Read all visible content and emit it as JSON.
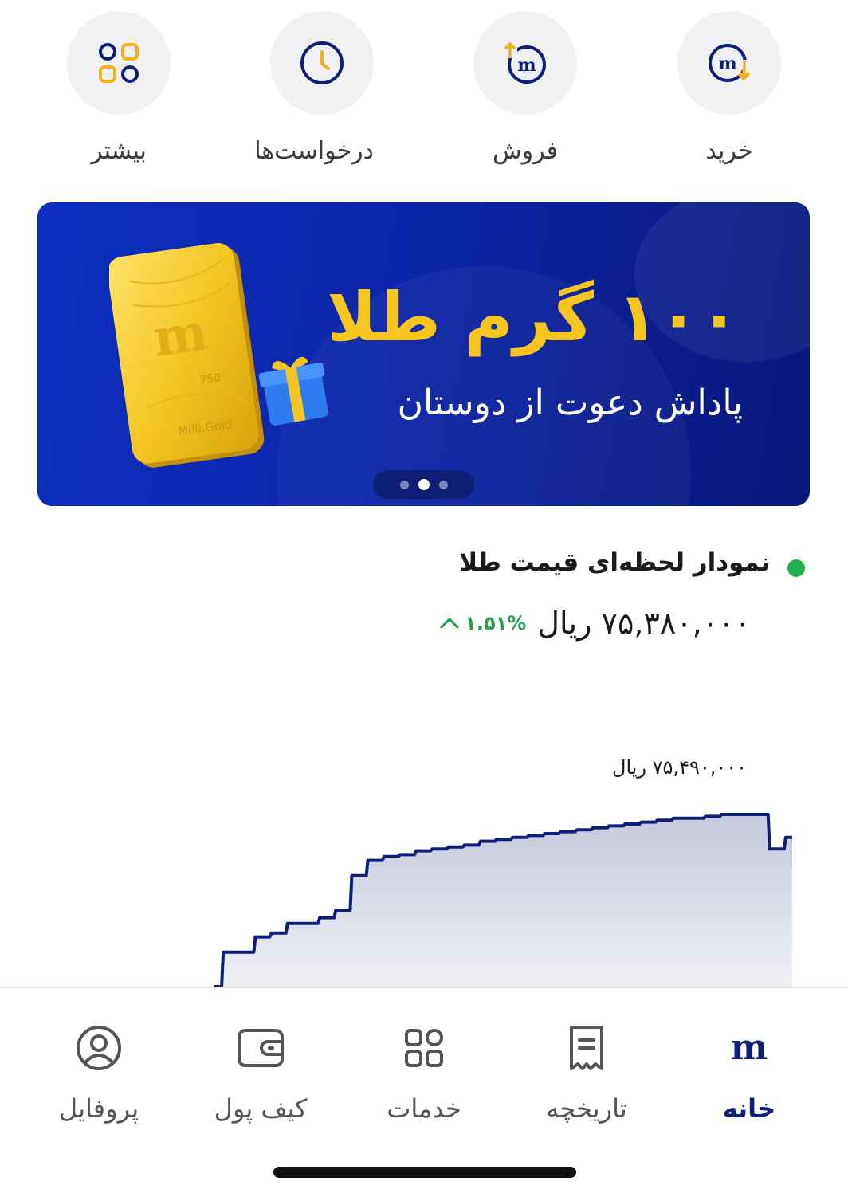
{
  "quick_actions": [
    {
      "label": "خرید",
      "icon": "buy-icon"
    },
    {
      "label": "فروش",
      "icon": "sell-icon"
    },
    {
      "label": "درخواست‌ها",
      "icon": "clock-icon"
    },
    {
      "label": "بیشتر",
      "icon": "grid-more-icon"
    }
  ],
  "banner": {
    "title": "۱۰۰ گرم طلا",
    "subtitle": "پاداش دعوت از دوستان",
    "bar_text": "Milli.Gold",
    "bar_karat": "750",
    "slide_count": 3,
    "active_slide": 2
  },
  "chart": {
    "title": "نمودار لحظه‌ای قیمت طلا",
    "live_color": "#22b24c",
    "price": "۷۵,۳۸۰,۰۰۰ ریال",
    "change": "۱.۵۱%",
    "change_color": "#22a04a",
    "max_label": "۷۵,۴۹۰,۰۰۰ ریال"
  },
  "chart_data": {
    "type": "area",
    "values": [
      0,
      0.18,
      0.18,
      0.26,
      0.28,
      0.33,
      0.33,
      0.36,
      0.4,
      0.58,
      0.66,
      0.68,
      0.69,
      0.71,
      0.72,
      0.73,
      0.74,
      0.76,
      0.77,
      0.78,
      0.79,
      0.8,
      0.81,
      0.82,
      0.83,
      0.84,
      0.85,
      0.86,
      0.87,
      0.88,
      0.88,
      0.89,
      0.9,
      0.9,
      0.9,
      0.72,
      0.78
    ]
  },
  "tabbar": {
    "items": [
      {
        "label": "خانه",
        "icon": "home-logo-icon",
        "active": true
      },
      {
        "label": "تاریخچه",
        "icon": "receipt-icon",
        "active": false
      },
      {
        "label": "خدمات",
        "icon": "services-grid-icon",
        "active": false
      },
      {
        "label": "کیف پول",
        "icon": "wallet-icon",
        "active": false
      },
      {
        "label": "پروفایل",
        "icon": "profile-icon",
        "active": false
      }
    ]
  },
  "colors": {
    "brand": "#0e1f7a",
    "accent": "#f7c520"
  }
}
